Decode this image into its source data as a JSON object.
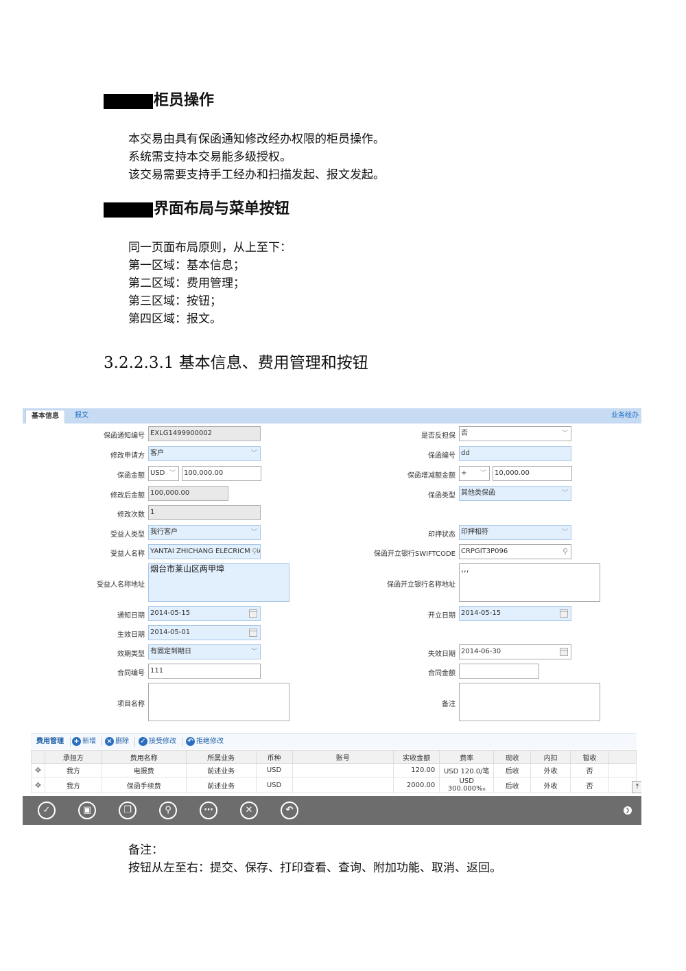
{
  "section1": {
    "title": "柜员操作",
    "lines": [
      "本交易由具有保函通知修改经办权限的柜员操作。",
      "系统需支持本交易能多级授权。",
      "该交易需要支持手工经办和扫描发起、报文发起。"
    ]
  },
  "section2": {
    "title": "界面布局与菜单按钮",
    "lines": [
      "同一页面布局原则，从上至下：",
      "第一区域：基本信息；",
      "第二区域：费用管理；",
      "第三区域：按钮；",
      "第四区域：报文。"
    ]
  },
  "section3": {
    "title": "3.2.2.3.1 基本信息、费用管理和按钮"
  },
  "screen": {
    "tabs": [
      "基本信息",
      "报文"
    ],
    "biz_link": "业务经办",
    "form": {
      "guarantee_notice_no": {
        "label": "保函通知编号",
        "value": "EXLG1499900002"
      },
      "counter_guarantee": {
        "label": "是否反担保",
        "value": "否"
      },
      "amend_applicant": {
        "label": "修改申请方",
        "value": "客户"
      },
      "guarantee_no": {
        "label": "保函编号",
        "value": "dd"
      },
      "guarantee_amount": {
        "label": "保函金额",
        "currency": "USD",
        "value": "100,000.00"
      },
      "inc_dec_amount": {
        "label": "保函增减额金额",
        "sign": "+",
        "value": "10,000.00"
      },
      "amended_amount": {
        "label": "修改后金额",
        "value": "100,000.00"
      },
      "guarantee_type": {
        "label": "保函类型",
        "value": "其他类保函"
      },
      "amend_count": {
        "label": "修改次数",
        "value": "1"
      },
      "beneficiary_type": {
        "label": "受益人类型",
        "value": "我行客户"
      },
      "seal_status": {
        "label": "印押状态",
        "value": "印押相符"
      },
      "beneficiary_name": {
        "label": "受益人名称",
        "value": "YANTAI ZHICHANG ELECRICM MA"
      },
      "issuing_swift": {
        "label": "保函开立银行SWIFTCODE",
        "value": "CRPGIT3P096"
      },
      "beneficiary_address": {
        "label": "受益人名称地址",
        "value": "烟台市莱山区两甲埠"
      },
      "issuing_bank_address": {
        "label": "保函开立银行名称地址",
        "value": ",,,"
      },
      "notice_date": {
        "label": "通知日期",
        "value": "2014-05-15"
      },
      "issue_date": {
        "label": "开立日期",
        "value": "2014-05-15"
      },
      "effective_date": {
        "label": "生效日期",
        "value": "2014-05-01"
      },
      "validity_type": {
        "label": "效期类型",
        "value": "有固定到期日"
      },
      "expiry_date": {
        "label": "失效日期",
        "value": "2014-06-30"
      },
      "contract_no": {
        "label": "合同编号",
        "value": "111"
      },
      "contract_amount": {
        "label": "合同金额",
        "value": ""
      },
      "project_name": {
        "label": "项目名称",
        "value": ""
      },
      "remark": {
        "label": "备注",
        "value": ""
      }
    },
    "fee": {
      "title": "费用管理",
      "buttons": {
        "add": "新增",
        "delete": "删除",
        "accept": "接受修改",
        "reject": "拒绝修改"
      },
      "headers": [
        "承担方",
        "费用名称",
        "所属业务",
        "币种",
        "账号",
        "实收金额",
        "费率",
        "现收",
        "内扣",
        "暂收"
      ],
      "rows": [
        [
          "我方",
          "电报费",
          "前述业务",
          "USD",
          "",
          "120.00",
          "USD 120.0/笔",
          "后收",
          "外收",
          "否"
        ],
        [
          "我方",
          "保函手续费",
          "前述业务",
          "USD",
          "",
          "2000.00",
          "USD 300.000%₀",
          "后收",
          "外收",
          "否"
        ]
      ]
    }
  },
  "notes": {
    "title": "备注：",
    "text": "按钮从左至右：提交、保存、打印查看、查询、附加功能、取消、返回。"
  }
}
